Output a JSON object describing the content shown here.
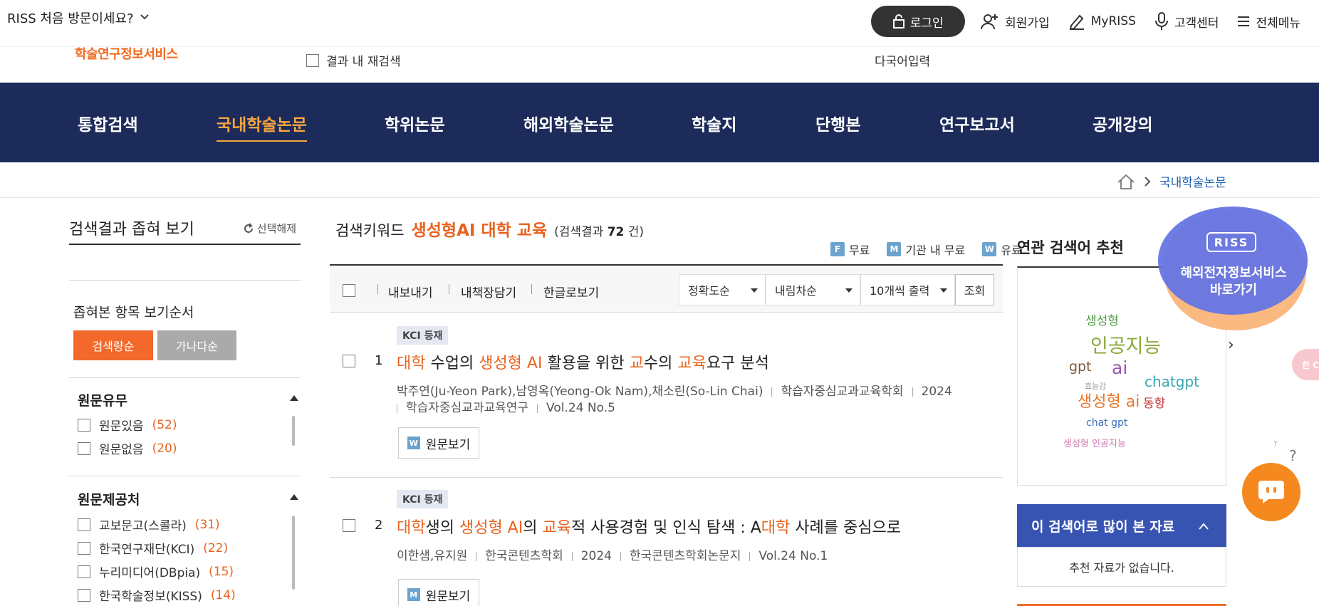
{
  "top": {
    "first_visit": "RISS 처음 방문이세요?",
    "logo_sub": "학술연구정보서비스",
    "recheck_label": "결과 내 재검색",
    "multilang": "다국어입력",
    "login": "로그인",
    "signup": "회원가입",
    "myriss": "MyRISS",
    "support": "고객센터",
    "allmenu": "전체메뉴"
  },
  "nav": {
    "items": [
      {
        "label": "통합검색"
      },
      {
        "label": "국내학술논문"
      },
      {
        "label": "학위논문"
      },
      {
        "label": "해외학술논문"
      },
      {
        "label": "학술지"
      },
      {
        "label": "단행본"
      },
      {
        "label": "연구보고서"
      },
      {
        "label": "공개강의"
      }
    ],
    "active_index": 1
  },
  "breadcrumb": {
    "current": "국내학술논문"
  },
  "sidebar": {
    "title": "검색결과 좁혀 보기",
    "reset": "선택해제",
    "order_label": "좁혀본 항목 보기순서",
    "sort_relevance": "검색량순",
    "sort_alpha": "가나다순",
    "facets": [
      {
        "title": "원문유무",
        "items": [
          {
            "label": "원문있음",
            "count": "(52)"
          },
          {
            "label": "원문없음",
            "count": "(20)"
          }
        ]
      },
      {
        "title": "원문제공처",
        "items": [
          {
            "label": "교보문고(스콜라)",
            "count": "(31)"
          },
          {
            "label": "한국연구재단(KCI)",
            "count": "(22)"
          },
          {
            "label": "누리미디어(DBpia)",
            "count": "(15)"
          },
          {
            "label": "한국학술정보(KISS)",
            "count": "(14)"
          }
        ]
      }
    ]
  },
  "search": {
    "keyword_label": "검색키워드",
    "keyword": "생성형AI 대학 교육",
    "count_prefix": "(검색결과",
    "count": "72",
    "count_suffix": "건)",
    "legend": [
      {
        "icon": "F",
        "label": "무료",
        "color": "#6aa3cf"
      },
      {
        "icon": "M",
        "label": "기관 내 무료",
        "color": "#6aa3cf"
      },
      {
        "icon": "W",
        "label": "유료",
        "color": "#6aa3cf"
      }
    ]
  },
  "toolbar": {
    "export": "내보내기",
    "save": "내책장담기",
    "hangul": "한글로보기",
    "sort_select": "정확도순",
    "order_select": "내림차순",
    "per_page_select": "10개씩 출력",
    "lookup": "조회"
  },
  "results": [
    {
      "badge": "KCI 등재",
      "num": "1",
      "title_parts": [
        {
          "t": "대학",
          "hl": true
        },
        {
          "t": " 수업의 ",
          "hl": false
        },
        {
          "t": "생성형 AI",
          "hl": true
        },
        {
          "t": " 활용을 위한 ",
          "hl": false
        },
        {
          "t": "교",
          "hl": true
        },
        {
          "t": "수의 ",
          "hl": false
        },
        {
          "t": "교육",
          "hl": true
        },
        {
          "t": "요구 분석",
          "hl": false
        }
      ],
      "authors": "박주연(Ju-Yeon Park),남영옥(Yeong-Ok Nam),채소린(So-Lin Chai)",
      "publisher": "학습자중심교과교육학회",
      "year": "2024",
      "journal": "학습자중심교과교육연구",
      "volume": "Vol.24 No.5",
      "view_icon": "W",
      "view_label": "원문보기"
    },
    {
      "badge": "KCI 등재",
      "num": "2",
      "title_parts": [
        {
          "t": "대학",
          "hl": true
        },
        {
          "t": "생의 ",
          "hl": false
        },
        {
          "t": "생성형 AI",
          "hl": true
        },
        {
          "t": "의 ",
          "hl": false
        },
        {
          "t": "교육",
          "hl": true
        },
        {
          "t": "적 사용경험 및 인식 탐색 : A",
          "hl": false
        },
        {
          "t": "대학",
          "hl": true
        },
        {
          "t": " 사례를 중심으로",
          "hl": false
        }
      ],
      "authors": "이한샘,유지원",
      "publisher": "한국콘텐츠학회",
      "year": "2024",
      "journal": "한국콘텐츠학회논문지",
      "volume": "Vol.24 No.1",
      "view_icon": "M",
      "view_label": "원문보기"
    }
  ],
  "related": {
    "title": "연관 검색어 추천",
    "words": [
      {
        "text": "생성형",
        "color": "#4a9a3c"
      },
      {
        "text": "인공지능",
        "color": "#8ba83a"
      },
      {
        "text": "gpt",
        "color": "#7a5a3a"
      },
      {
        "text": "ai",
        "color": "#9a5ab0"
      },
      {
        "text": "chatgpt",
        "color": "#3aa6b3"
      },
      {
        "text": "효능감",
        "color": "#9a9a9a"
      },
      {
        "text": "생성형 ai",
        "color": "#e8762a"
      },
      {
        "text": "동향",
        "color": "#c33a3a"
      },
      {
        "text": "chat gpt",
        "color": "#3a6fb3"
      },
      {
        "text": "생성형 인공지능",
        "color": "#d27ab3"
      }
    ]
  },
  "most_viewed": {
    "title": "이 검색어로 많이 본 자료",
    "empty": "추천 자료가 없습니다."
  },
  "floating": {
    "riss_logo": "RISS",
    "riss_line1": "해외전자정보서비스",
    "riss_line2": "바로가기",
    "help": "?",
    "help_small": "?",
    "side_tab": "한 CA"
  }
}
